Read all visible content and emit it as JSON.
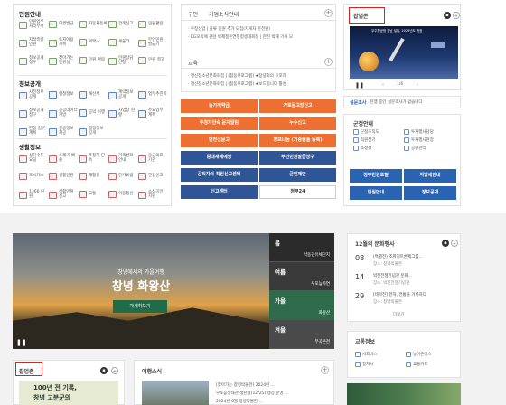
{
  "info_panel": {
    "section1": "민원안내",
    "section1_items": [
      "민원업무 처리부서",
      "여권발급",
      "자동차등록",
      "건축신고",
      "민원편람",
      "지적측량 민원",
      "토지이용 계획",
      "위택스",
      "세올터",
      "무인민원 발급기",
      "정보공개 청구",
      "찾아가는 민원실",
      "민원 편람",
      "민원상담 신청",
      "민원 결과"
    ],
    "section2": "정보공개",
    "section2_items": [
      "사전정보 공개",
      "행정정보",
      "예산서",
      "계약정보 공개",
      "업무추진비",
      "정보공개 청구",
      "공공데이터 개방",
      "공약 이행",
      "사업장 현황",
      "주요업무 계획",
      "관청 업무계획",
      "공공정보 제공",
      "행정정보 공개"
    ],
    "section3": "생활정보",
    "section3_items": [
      "상하수도 요금",
      "쓰레기 배출",
      "주정차 단속",
      "가족센터 안내",
      "응급의료 기관",
      "도시가스",
      "생활민원",
      "재활용",
      "전기요금",
      "전입신고",
      "1366 민원",
      "생활민원 신고",
      "교통",
      "이동통신",
      "소상공인 지원"
    ]
  },
  "notice_panel": {
    "tab1": "구인",
    "tab2": "기업소식안내",
    "lines": [
      "· 우창산업 | 물류 인원 추가 모집(지게차 운전원)",
      "· KG모빅에 관련 박제정돈연정청생대회정 | 한진 박해 기사 모"
    ],
    "edu_title": "교육",
    "edu_lines": [
      "· 쟁선청소년문화회집 | [참동프로그램] ★창녕회의 유포자",
      "· 쟁선청소년문화회집 | [참동프로그램] ★보드립니다 활성"
    ]
  },
  "buttons": [
    [
      "농가계약금",
      "가로등고장신고"
    ],
    [
      "주정차단속 문자알림",
      "누수신고"
    ],
    [
      "안전신문고",
      "정보나눔 (기증물품 등록)"
    ],
    [
      "중대재해예방",
      "무인민원발급장구"
    ],
    [
      "공직자의 직원신고센터",
      "군민제안"
    ],
    [
      "신고센터",
      "정부24"
    ]
  ],
  "popup": {
    "label": "팝업존",
    "banner_text": "우주항공청 경남 설립, 2023년도 개청",
    "counter": "1/6",
    "link1": "설문조사",
    "link2": "진행 중인 설문조사가 없습니다",
    "service_title": "군정안내",
    "services": [
      "군청조직도",
      "투자행사담당",
      "직원찾기",
      "투자행사현장",
      "조정청",
      "공원관리"
    ],
    "buttons": [
      "정부민원포털",
      "지방세안내",
      "민원안내",
      "정보공개"
    ]
  },
  "hero": {
    "subtitle": "창녕에서의 가을여행",
    "title": "창녕 화왕산",
    "button": "자세히보기",
    "seasons": [
      {
        "name": "봄",
        "sub": "낙동강유채단지"
      },
      {
        "name": "여름",
        "sub": "우포늪자연"
      },
      {
        "name": "가을",
        "sub": "화왕산"
      },
      {
        "name": "겨울",
        "sub": "부곡온천"
      }
    ]
  },
  "events": {
    "title": "12월의 문화행사",
    "items": [
      {
        "day": "08",
        "text": "(특별전) 조파지트론세그룹...",
        "place": "장소: 창녕박물관"
      },
      {
        "day": "14",
        "text": "박진전쟁기념관 문화...",
        "place": "장소: 박진전쟁기념관"
      },
      {
        "day": "29",
        "text": "[테마전] 한자, 전통을 기록하다",
        "place": "장소: 창녕박물관"
      }
    ],
    "more": "더보기"
  },
  "traffic": {
    "title": "교통정보",
    "links": [
      "시외버스",
      "농어촌버스",
      "열차시",
      "교통카드"
    ]
  },
  "bottom": {
    "popup_label": "팝업존",
    "travel_title": "여행소식",
    "line1": "[찾아가는 창녕박물관] 2024년 ...",
    "line2": "우포늪생태관 생탄절(12/25) 행상 운영 ...",
    "line3": "2024년 6월 창녕박물관 ...",
    "banner_text1": "100년 전 기록,",
    "banner_text2": "창녕 고분군의"
  }
}
